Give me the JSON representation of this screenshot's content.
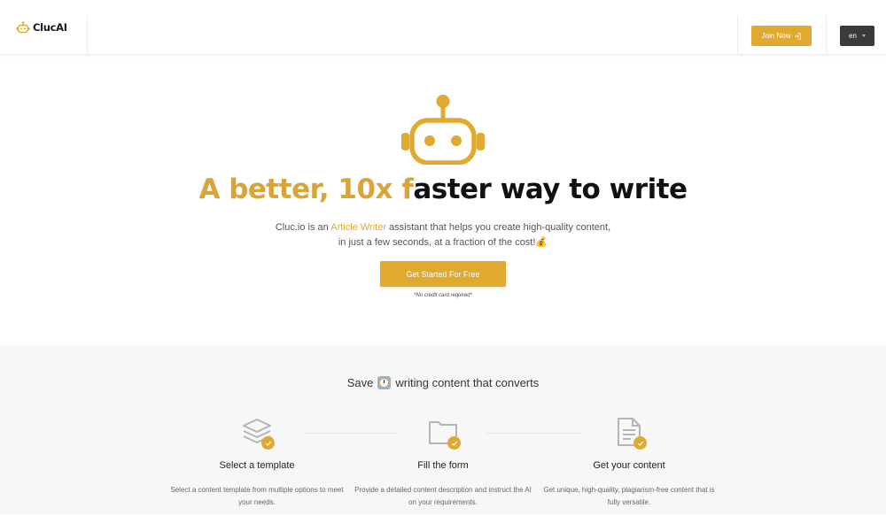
{
  "header": {
    "logo_text": "ClucAI",
    "join_label": "Join Now",
    "language": "en"
  },
  "hero": {
    "title_accent": "A better, 10x f",
    "title_rest": "aster way to write",
    "desc_prefix": "Cluc.io is an ",
    "desc_highlight": "Article Writer",
    "desc_suffix": " assistant that helps you create high-quality content,",
    "desc_line2": "in just a few seconds, at a fraction of the cost!",
    "desc_emoji": "💰",
    "cta_label": "Get Started For Free",
    "note": "*No credit card required*"
  },
  "features": {
    "title_prefix": "Save",
    "title_suffix": "writing content that converts",
    "steps": [
      {
        "icon": "layers-icon",
        "title": "Select a template",
        "desc": "Select a content template from multiple options to meet your needs."
      },
      {
        "icon": "folder-icon",
        "title": "Fill the form",
        "desc": "Provide a detailed content description and instruct the AI on your requirements."
      },
      {
        "icon": "document-icon",
        "title": "Get your content",
        "desc": "Get unique, high-quality, plagiarism-free content that is fully versatile."
      }
    ]
  },
  "colors": {
    "accent": "#e0a930",
    "dark_button": "#3a3a3a",
    "section_bg": "#f7f7f7"
  }
}
